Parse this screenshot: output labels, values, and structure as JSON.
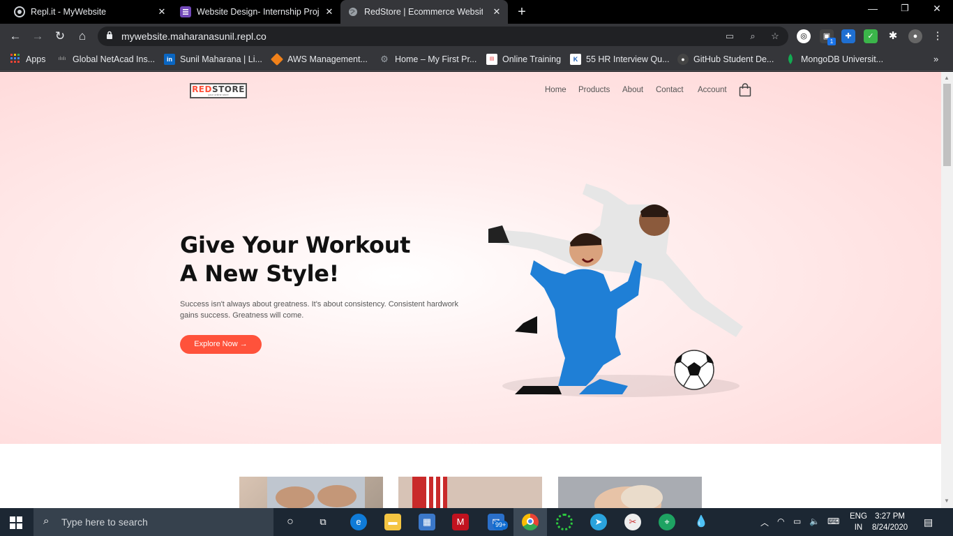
{
  "browser": {
    "tabs": [
      {
        "title": "Repl.it - MyWebsite",
        "icon": "replit-icon",
        "active": false
      },
      {
        "title": "Website Design- Internship Proje",
        "icon": "forms-icon",
        "active": false
      },
      {
        "title": "RedStore | Ecommerce Website D",
        "icon": "globe-icon",
        "active": true
      }
    ],
    "url": "mywebsite.maharanasunil.repl.co",
    "bookmarks": [
      {
        "label": "Apps",
        "icon": "apps-grid-icon"
      },
      {
        "label": "Global NetAcad Ins...",
        "icon": "cisco-icon"
      },
      {
        "label": "Sunil Maharana | Li...",
        "icon": "linkedin-icon"
      },
      {
        "label": "AWS Management...",
        "icon": "aws-icon"
      },
      {
        "label": "Home – My First Pr...",
        "icon": "gear-icon"
      },
      {
        "label": "Online Training",
        "icon": "training-icon"
      },
      {
        "label": "55 HR Interview Qu...",
        "icon": "bookmark-k-icon"
      },
      {
        "label": "GitHub Student De...",
        "icon": "github-icon"
      },
      {
        "label": "MongoDB Universit...",
        "icon": "mongodb-leaf-icon"
      }
    ],
    "extension_badge": "1"
  },
  "site": {
    "logo": {
      "red": "RED",
      "dark": "STORE",
      "tagline": "your online store"
    },
    "nav": [
      "Home",
      "Products",
      "About",
      "Contact",
      "Account"
    ],
    "hero": {
      "headline_line1": "Give Your Workout",
      "headline_line2": "A New Style!",
      "subtext": "Success isn't always about greatness. It's about consistency. Consistent hardwork gains success. Greatness will come.",
      "cta": "Explore Now →"
    },
    "colors": {
      "accent": "#ff523b",
      "hero_bg": "#ffd6d6"
    }
  },
  "taskbar": {
    "search_placeholder": "Type here to search",
    "mail_badge": "99+",
    "language": "ENG",
    "region": "IN",
    "time": "3:27 PM",
    "date": "8/24/2020"
  }
}
